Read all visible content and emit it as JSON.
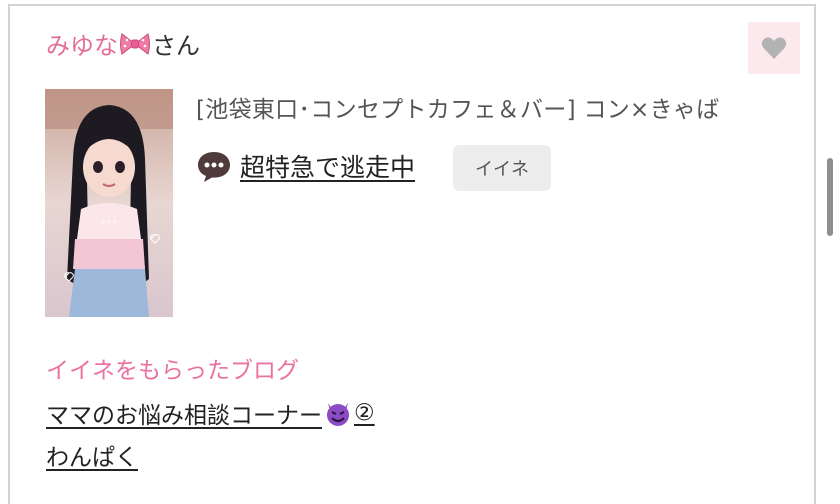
{
  "user": {
    "name": "みゆな",
    "ribbon_icon": "pink-ribbon-emoji",
    "suffix": "さん"
  },
  "favorite_button": {
    "icon": "heart-icon",
    "icon_color": "#b3b3b3",
    "bg_color": "#fbe9ee"
  },
  "post": {
    "shop_text": "[池袋東口･コンセプトカフェ＆バー]  コン×きゃば",
    "status_icon": "speech-bubble-icon",
    "status_text": "超特急で逃走中",
    "like_button_label": "イイネ"
  },
  "liked_blogs": {
    "heading": "イイネをもらったブログ",
    "items": [
      {
        "title": "ママのお悩み相談コーナー",
        "emoji": "smiling-devil-emoji",
        "suffix": "②"
      },
      {
        "title": "わんぱく",
        "emoji": "",
        "suffix": ""
      }
    ]
  },
  "colors": {
    "name_pink": "#e56f93",
    "heading_pink": "#ea72a1",
    "border": "#d3d3d3"
  }
}
